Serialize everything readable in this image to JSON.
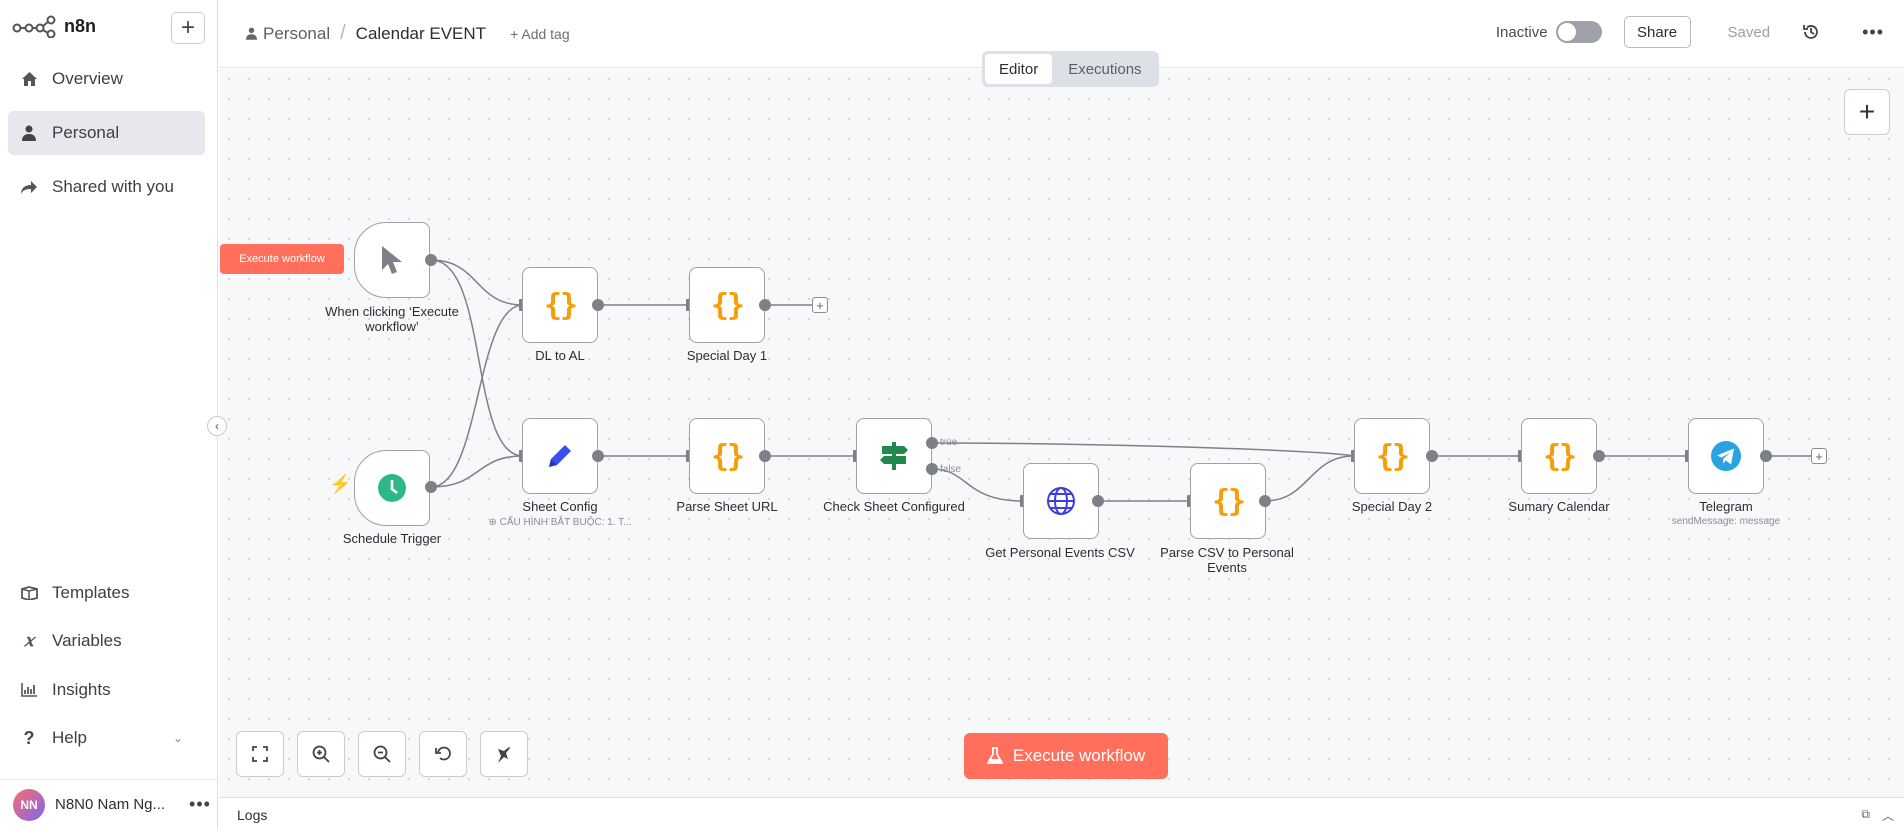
{
  "app": {
    "brand": "n8n"
  },
  "sidebar": {
    "new_button": "+",
    "items": [
      {
        "label": "Overview",
        "icon": "home-icon"
      },
      {
        "label": "Personal",
        "icon": "user-icon",
        "active": true
      },
      {
        "label": "Shared with you",
        "icon": "share-icon"
      }
    ],
    "bottom_items": [
      {
        "label": "Templates",
        "icon": "box-icon"
      },
      {
        "label": "Variables",
        "icon": "variable-icon"
      },
      {
        "label": "Insights",
        "icon": "chart-icon"
      },
      {
        "label": "Help",
        "icon": "question-icon"
      }
    ],
    "user": {
      "initials": "NN",
      "name": "N8N0 Nam Ng..."
    }
  },
  "header": {
    "project": "Personal",
    "separator": "/",
    "workflow_name": "Calendar EVENT",
    "add_tag": "+ Add tag",
    "status_label": "Inactive",
    "share_label": "Share",
    "saved_label": "Saved",
    "tabs": [
      {
        "label": "Editor",
        "active": true
      },
      {
        "label": "Executions"
      }
    ]
  },
  "canvas": {
    "execute_small": "Execute workflow",
    "execute_main": "Execute workflow",
    "nodes": [
      {
        "id": "manual",
        "label": "When clicking ‘Execute workflow’",
        "icon": "cursor-icon"
      },
      {
        "id": "schedule",
        "label": "Schedule Trigger",
        "icon": "clock-icon"
      },
      {
        "id": "dl",
        "label": "DL to AL",
        "icon": "code-braces-icon"
      },
      {
        "id": "sd1",
        "label": "Special Day 1",
        "icon": "code-braces-icon"
      },
      {
        "id": "sheet",
        "label": "Sheet Config",
        "sublabel": "CẤU HÌNH BẮT BUỘC: 1. T...",
        "icon": "pencil-icon"
      },
      {
        "id": "parse",
        "label": "Parse Sheet URL",
        "icon": "code-braces-icon"
      },
      {
        "id": "check",
        "label": "Check Sheet Configured",
        "icon": "signpost-icon"
      },
      {
        "id": "get",
        "label": "Get Personal Events CSV",
        "icon": "globe-icon"
      },
      {
        "id": "csv",
        "label": "Parse CSV to Personal Events",
        "icon": "code-braces-icon"
      },
      {
        "id": "sd2",
        "label": "Special Day 2",
        "icon": "code-braces-icon"
      },
      {
        "id": "sum",
        "label": "Sumary Calendar",
        "icon": "code-braces-icon"
      },
      {
        "id": "tg",
        "label": "Telegram",
        "sublabel": "sendMessage: message",
        "icon": "telegram-icon"
      }
    ],
    "branch_true": "true",
    "branch_false": "false"
  },
  "logs": {
    "label": "Logs"
  },
  "colors": {
    "accent": "#ff6f5c",
    "code": "#f59e0b",
    "schedule": "#2eb88a",
    "telegram": "#2aa3e0"
  }
}
